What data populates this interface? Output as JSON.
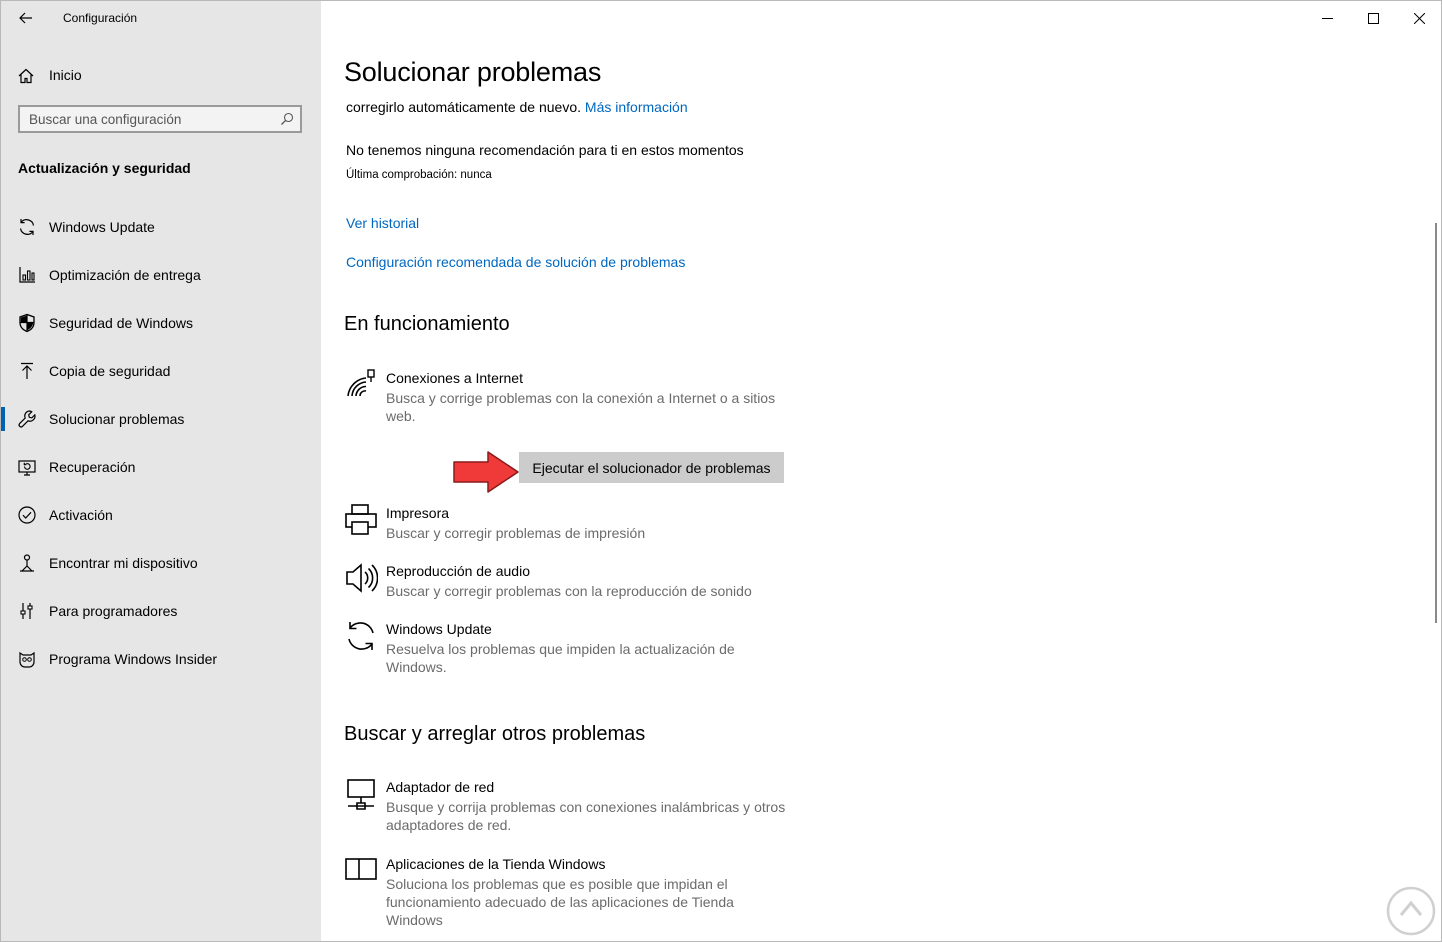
{
  "window": {
    "title": "Configuración"
  },
  "sidebar": {
    "home_label": "Inicio",
    "search_placeholder": "Buscar una configuración",
    "section_title": "Actualización y seguridad",
    "items": [
      {
        "label": "Windows Update",
        "icon": "sync-icon"
      },
      {
        "label": "Optimización de entrega",
        "icon": "delivery-optimization-icon"
      },
      {
        "label": "Seguridad de Windows",
        "icon": "shield-icon"
      },
      {
        "label": "Copia de seguridad",
        "icon": "backup-arrow-icon"
      },
      {
        "label": "Solucionar problemas",
        "icon": "wrench-icon",
        "active": true
      },
      {
        "label": "Recuperación",
        "icon": "recovery-icon"
      },
      {
        "label": "Activación",
        "icon": "check-circle-icon"
      },
      {
        "label": "Encontrar mi dispositivo",
        "icon": "person-pin-icon"
      },
      {
        "label": "Para programadores",
        "icon": "developer-sliders-icon"
      },
      {
        "label": "Programa Windows Insider",
        "icon": "insider-cat-icon"
      }
    ]
  },
  "main": {
    "title": "Solucionar problemas",
    "intro_text": "corregirlo automáticamente de nuevo.",
    "intro_link": "Más información",
    "no_recommendation": "No tenemos ninguna recomendación para ti en estos momentos",
    "last_check": "Última comprobación: nunca",
    "history_link": "Ver historial",
    "recommended_settings_link": "Configuración recomendada de solución de problemas",
    "running_section": {
      "title": "En funcionamiento",
      "items": [
        {
          "title": "Conexiones a Internet",
          "desc": "Busca y corrige problemas con la conexión a Internet o a sitios web.",
          "icon": "internet-connection-icon"
        },
        {
          "title": "Impresora",
          "desc": "Buscar y corregir problemas de impresión",
          "icon": "printer-icon"
        },
        {
          "title": "Reproducción de audio",
          "desc": "Buscar y corregir problemas con la reproducción de sonido",
          "icon": "speaker-icon"
        },
        {
          "title": "Windows Update",
          "desc": "Resuelva los problemas que impiden la actualización de Windows.",
          "icon": "sync-icon"
        }
      ],
      "run_button": "Ejecutar el solucionador de problemas"
    },
    "other_section": {
      "title": "Buscar y arreglar otros problemas",
      "items": [
        {
          "title": "Adaptador de red",
          "desc": "Busque y corrija problemas con conexiones inalámbricas y otros adaptadores de red.",
          "icon": "network-adapter-icon"
        },
        {
          "title": "Aplicaciones de la Tienda Windows",
          "desc": "Soluciona los problemas que es posible que impidan el funcionamiento adecuado de las aplicaciones de Tienda Windows",
          "icon": "store-apps-icon"
        }
      ]
    }
  },
  "colors": {
    "accent": "#0067c0",
    "sidebar_bg": "#e6e6e6",
    "annotation_arrow": "#f03a3a"
  }
}
